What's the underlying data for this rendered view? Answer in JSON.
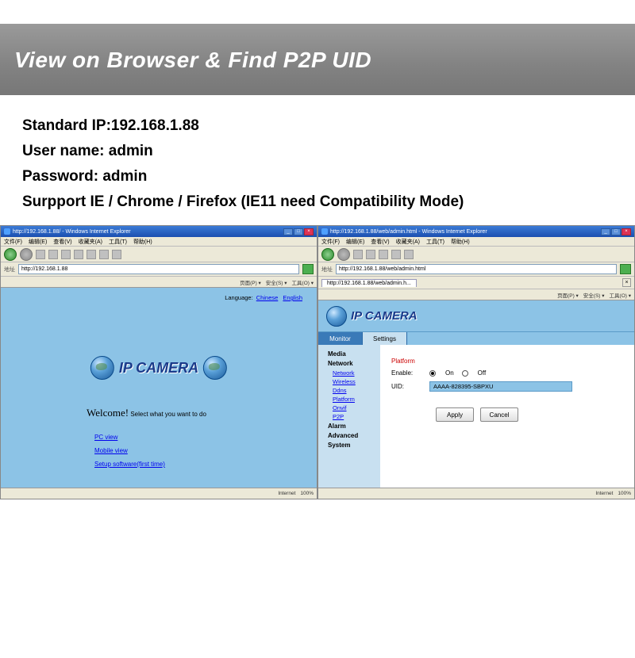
{
  "banner": "View on Browser & Find P2P UID",
  "info": {
    "ip": "Standard IP:192.168.1.88",
    "user": "User name: admin",
    "pw": "Password: admin",
    "support": "Surpport IE / Chrome / Firefox (IE11 need Compatibility Mode)"
  },
  "left": {
    "title": "http://192.168.1.88/ - Windows Internet Explorer",
    "menu": [
      "文件(F)",
      "编辑(E)",
      "查看(V)",
      "收藏夹(A)",
      "工具(T)",
      "帮助(H)"
    ],
    "addr_label": "地址",
    "address": "http://192.168.1.88",
    "linksbar": [
      "页面(P) ▾",
      "安全(S) ▾",
      "工具(O) ▾"
    ],
    "lang_label": "Language:",
    "lang_opts": [
      "Chinese",
      "English"
    ],
    "brand": "IP CAMERA",
    "welcome": "Welcome!",
    "welcome_sub": "Select what you want to do",
    "links": [
      "PC view",
      "Mobile view",
      "Setup software(first time)"
    ],
    "status_left": "",
    "status_right": [
      "Internet",
      "100%"
    ]
  },
  "right": {
    "title": "http://192.168.1.88/web/admin.html - Windows Internet Explorer",
    "address": "http://192.168.1.88/web/admin.html",
    "tab_label": "http://192.168.1.88/web/admin.h...",
    "brand": "IP CAMERA",
    "tabs": [
      "Monitor",
      "Settings"
    ],
    "side": {
      "media": "Media",
      "network": "Network",
      "net_items": [
        "Network",
        "Wireless",
        "Ddns",
        "Platform",
        "Onvif",
        "P2P"
      ],
      "alarm": "Alarm",
      "advanced": "Advanced",
      "system": "System"
    },
    "panel": {
      "platform_label": "Platform",
      "enable_label": "Enable:",
      "on": "On",
      "off": "Off",
      "uid_label": "UID:",
      "uid_value": "AAAA-828395-SBPXU",
      "apply": "Apply",
      "cancel": "Cancel"
    },
    "status_right": [
      "Internet",
      "100%"
    ]
  }
}
